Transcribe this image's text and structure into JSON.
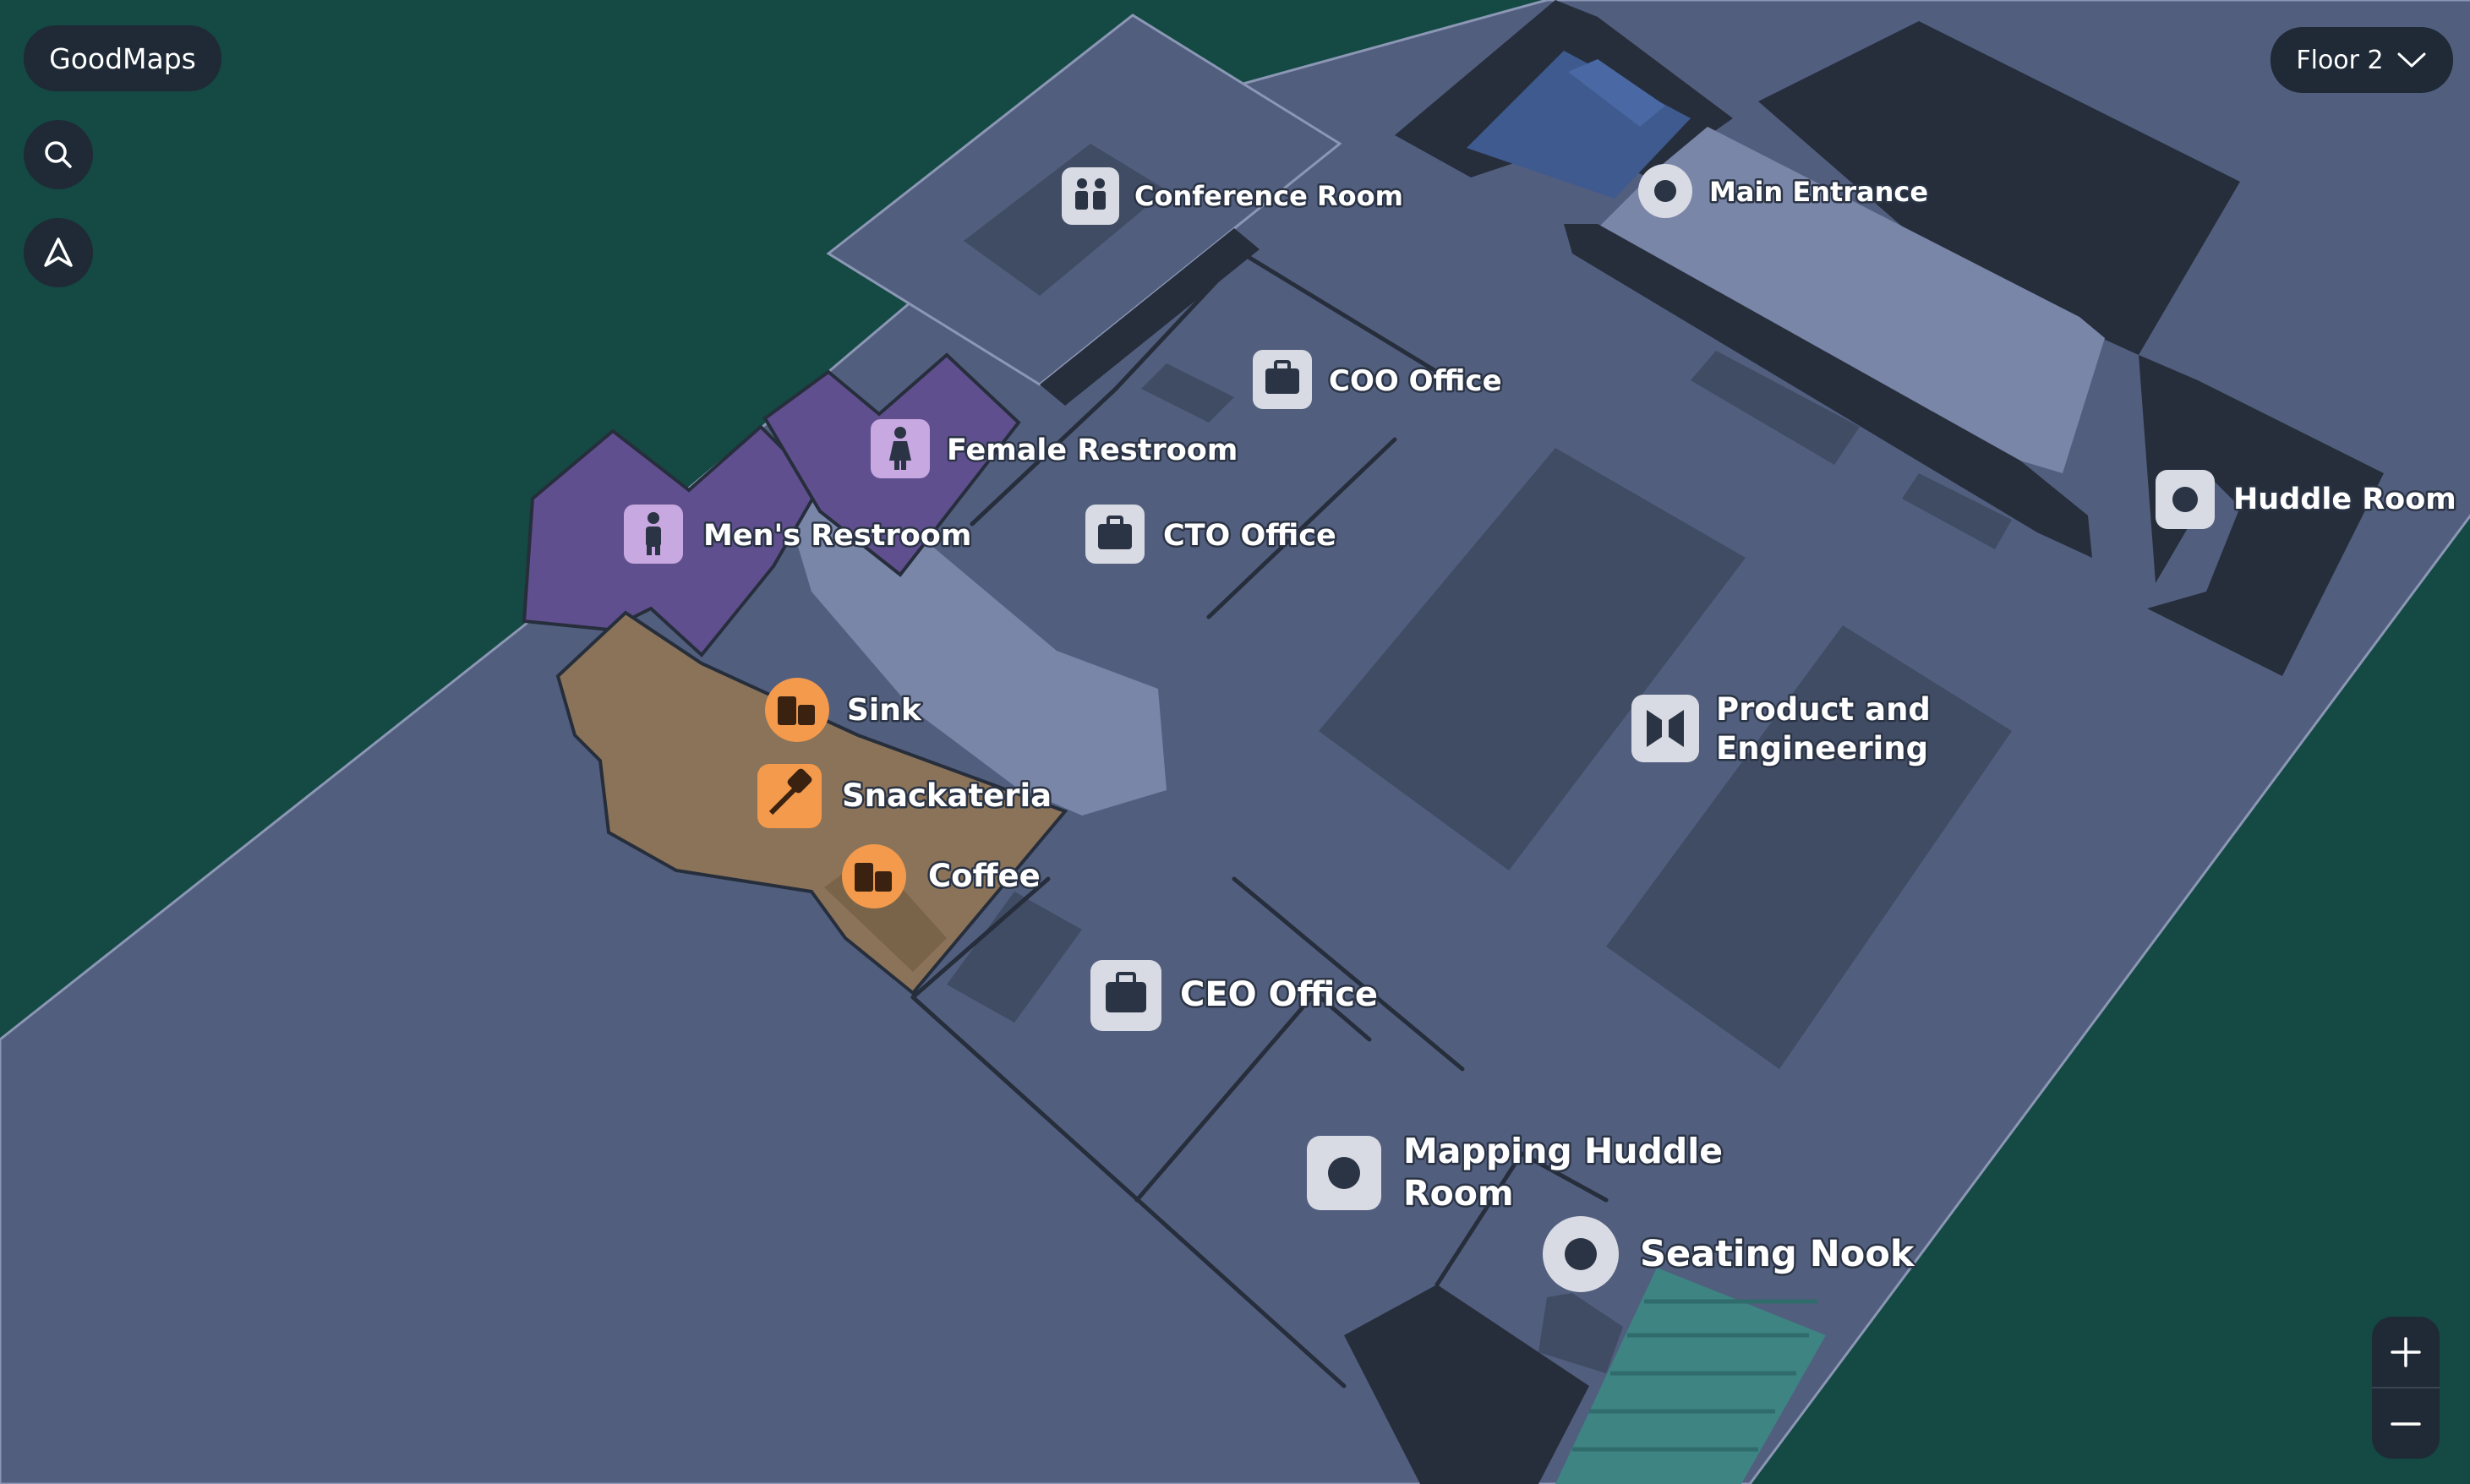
{
  "app": {
    "brand": "GoodMaps"
  },
  "floor_selector": {
    "label": "Floor 2"
  },
  "icons": {
    "search": "search-icon",
    "navigate": "navigation-arrow-icon",
    "chevron": "chevron-down-icon",
    "zoom_in": "plus-icon",
    "zoom_out": "minus-icon"
  },
  "colors": {
    "outdoor": "#144944",
    "floor": "#525e7e",
    "corridor": "#7a86a8",
    "room_dark": "#404b64",
    "wall": "#262e3c",
    "restroom": "#604f8e",
    "food": "#8a7358",
    "entrance": "#3f5a8f",
    "stairs": "#3d8483",
    "office_badge": "#d8dbe3",
    "restroom_badge": "#c8a8e0",
    "food_badge": "#f39a4c",
    "controls": "#1f2a36"
  },
  "pois": {
    "conference": {
      "label": "Conference Room",
      "icon": "people-icon"
    },
    "main_entrance": {
      "label": "Main Entrance",
      "icon": "dot-icon"
    },
    "coo": {
      "label": "COO Office",
      "icon": "briefcase-icon"
    },
    "female": {
      "label": "Female Restroom",
      "icon": "female-icon"
    },
    "mens": {
      "label": "Men's Restroom",
      "icon": "male-icon"
    },
    "cto": {
      "label": "CTO Office",
      "icon": "briefcase-icon"
    },
    "huddle": {
      "label": "Huddle Room",
      "icon": "dot-icon"
    },
    "sink": {
      "label": "Sink",
      "icon": "cups-icon"
    },
    "snack": {
      "label": "Snackateria",
      "icon": "spatula-icon"
    },
    "coffee": {
      "label": "Coffee",
      "icon": "cups-icon"
    },
    "product": {
      "label_line1": "Product and",
      "label_line2": "Engineering",
      "icon": "open-space-icon"
    },
    "ceo": {
      "label": "CEO Office",
      "icon": "briefcase-icon"
    },
    "mapping": {
      "label_line1": "Mapping Huddle",
      "label_line2": "Room",
      "icon": "dot-icon"
    },
    "seating": {
      "label": "Seating Nook",
      "icon": "dot-icon"
    }
  }
}
